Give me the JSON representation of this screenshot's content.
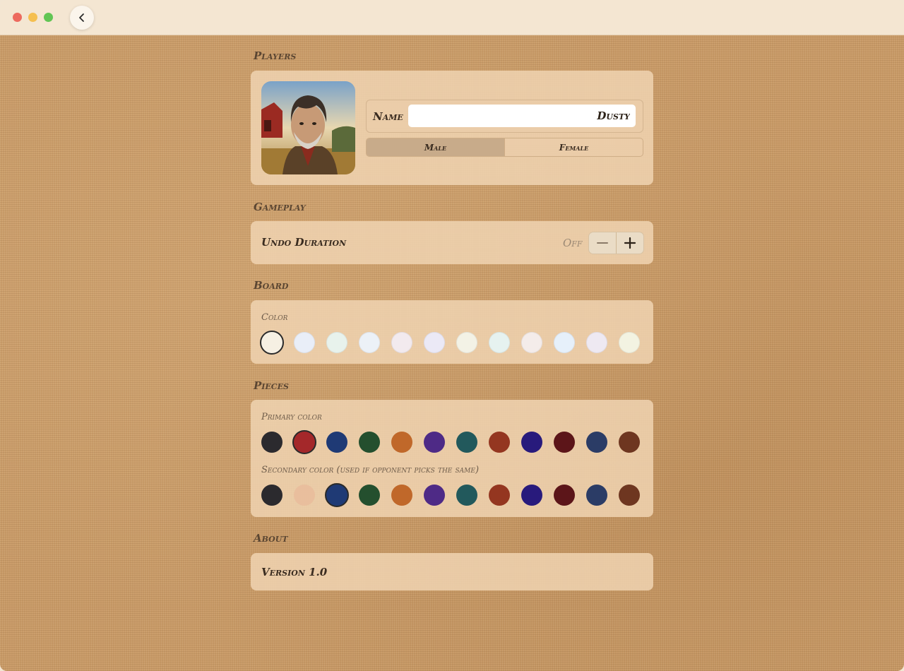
{
  "window": {
    "back_label": "back"
  },
  "players": {
    "section_title": "Players",
    "name_label": "Name",
    "name_value": "Dusty",
    "gender_options": [
      "Male",
      "Female"
    ],
    "selected_gender": "Male"
  },
  "gameplay": {
    "section_title": "Gameplay",
    "undo_label": "Undo Duration",
    "undo_value": "Off",
    "minus_icon": "minus-icon",
    "plus_icon": "plus-icon"
  },
  "board": {
    "section_title": "Board",
    "color_label": "Color",
    "colors": [
      "#f6f0e3",
      "#e9eef8",
      "#e8f2ec",
      "#ecf1f7",
      "#f2eaee",
      "#ebe9f6",
      "#f3f2e6",
      "#e6f2f0",
      "#f4ecea",
      "#e6f0fa",
      "#eee9f2",
      "#f3f3e2"
    ],
    "selected_index": 0
  },
  "pieces": {
    "section_title": "Pieces",
    "primary_label": "Primary color",
    "secondary_label": "Secondary color (used if opponent picks the same)",
    "primary_colors": [
      "#2b2a2e",
      "#a4282a",
      "#1f3a75",
      "#244f2e",
      "#c0682a",
      "#4e2a86",
      "#22595c",
      "#943620",
      "#281a7c",
      "#5c1519",
      "#2b3c66",
      "#6e3620"
    ],
    "primary_selected_index": 1,
    "secondary_colors": [
      "#2b2a2e",
      "#e9bc9b",
      "#1f3a75",
      "#244f2e",
      "#c0682a",
      "#4e2a86",
      "#22595c",
      "#943620",
      "#281a7c",
      "#5c1519",
      "#2b3c66",
      "#6e3620"
    ],
    "secondary_selected_index": 2,
    "secondary_disabled_index": 1
  },
  "about": {
    "section_title": "About",
    "version_label": "Version 1.0"
  }
}
